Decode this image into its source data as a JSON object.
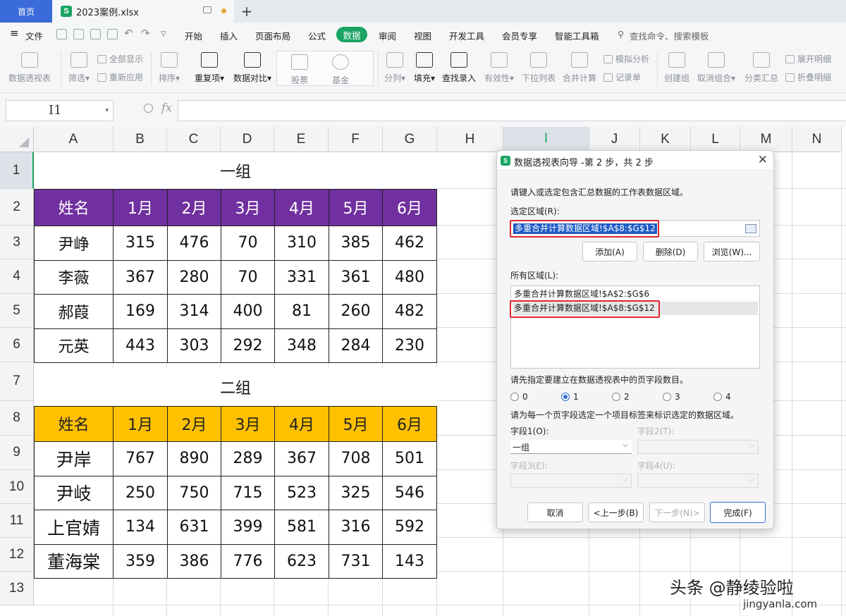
{
  "tabs": {
    "home": "首页",
    "file": "2023案例.xlsx"
  },
  "menu": {
    "file": "文件",
    "items": [
      "开始",
      "插入",
      "页面布局",
      "公式",
      "数据",
      "审阅",
      "视图",
      "开发工具",
      "会员专享",
      "智能工具箱"
    ],
    "search": "查找命令、搜索模板"
  },
  "ribbon": {
    "pivot": "数据透视表",
    "filter": "筛选",
    "show_all": "全部显示",
    "reapply": "重新应用",
    "sort": "排序",
    "duplicates": "重复项",
    "compare": "数据对比",
    "stock": "股票",
    "fund": "基金",
    "split": "分列",
    "fill": "填充",
    "lookup": "查找录入",
    "validity": "有效性",
    "dropdown": "下拉列表",
    "consolidate": "合并计算",
    "whatif": "模拟分析",
    "record": "记录单",
    "group": "创建组",
    "ungroup": "取消组合",
    "subtotal": "分类汇总",
    "expand": "展开明细",
    "collapse": "折叠明细"
  },
  "formula": {
    "namebox": "I1",
    "fx": "fx"
  },
  "columns": [
    "A",
    "B",
    "C",
    "D",
    "E",
    "F",
    "G",
    "H",
    "I",
    "J",
    "K",
    "L",
    "M",
    "N"
  ],
  "rows": [
    "1",
    "2",
    "3",
    "4",
    "5",
    "6",
    "7",
    "8",
    "9",
    "10",
    "11",
    "12",
    "13"
  ],
  "sheet": {
    "group1": {
      "title": "一组",
      "headers": [
        "姓名",
        "1月",
        "2月",
        "3月",
        "4月",
        "5月",
        "6月"
      ],
      "rows": [
        [
          "尹峥",
          "315",
          "476",
          "70",
          "310",
          "385",
          "462"
        ],
        [
          "李薇",
          "367",
          "280",
          "70",
          "331",
          "361",
          "480"
        ],
        [
          "郝葭",
          "169",
          "314",
          "400",
          "81",
          "260",
          "482"
        ],
        [
          "元英",
          "443",
          "303",
          "292",
          "348",
          "284",
          "230"
        ]
      ]
    },
    "group2": {
      "title": "二组",
      "headers": [
        "姓名",
        "1月",
        "2月",
        "3月",
        "4月",
        "5月",
        "6月"
      ],
      "rows": [
        [
          "尹岸",
          "767",
          "890",
          "289",
          "367",
          "708",
          "501"
        ],
        [
          "尹岐",
          "250",
          "750",
          "715",
          "523",
          "325",
          "546"
        ],
        [
          "上官婧",
          "134",
          "631",
          "399",
          "581",
          "316",
          "592"
        ],
        [
          "董海棠",
          "359",
          "386",
          "776",
          "623",
          "731",
          "143"
        ]
      ]
    }
  },
  "dialog": {
    "title": "数据透视表向导 -第 2 步，共 2 步",
    "instruction": "请键入或选定包含汇总数据的工作表数据区域。",
    "range_label": "选定区域(R):",
    "range_value": "多重合并计算数据区域!$A$8:$G$12",
    "btn_add": "添加(A)",
    "btn_delete": "删除(D)",
    "btn_browse": "浏览(W)...",
    "all_ranges_label": "所有区域(L):",
    "all_ranges": [
      "多重合并计算数据区域!$A$2:$G$6",
      "多重合并计算数据区域!$A$8:$G$12"
    ],
    "page_fields_label": "请先指定要建立在数据透视表中的页字段数目。",
    "radio": [
      "0",
      "1",
      "2",
      "3",
      "4"
    ],
    "label_prompt": "请为每一个页字段选定一个项目标签来标识选定的数据区域。",
    "field1_label": "字段1(O):",
    "field1_value": "一组",
    "field2_label": "字段2(T):",
    "field3_label": "字段3(E):",
    "field4_label": "字段4(U):",
    "btn_cancel": "取消",
    "btn_prev": "<上一步(B)",
    "btn_next": "下一步(N)>",
    "btn_finish": "完成(F)"
  },
  "watermark": {
    "line1": "头条 @静绫验啦",
    "line2": "jingyanla.com"
  }
}
